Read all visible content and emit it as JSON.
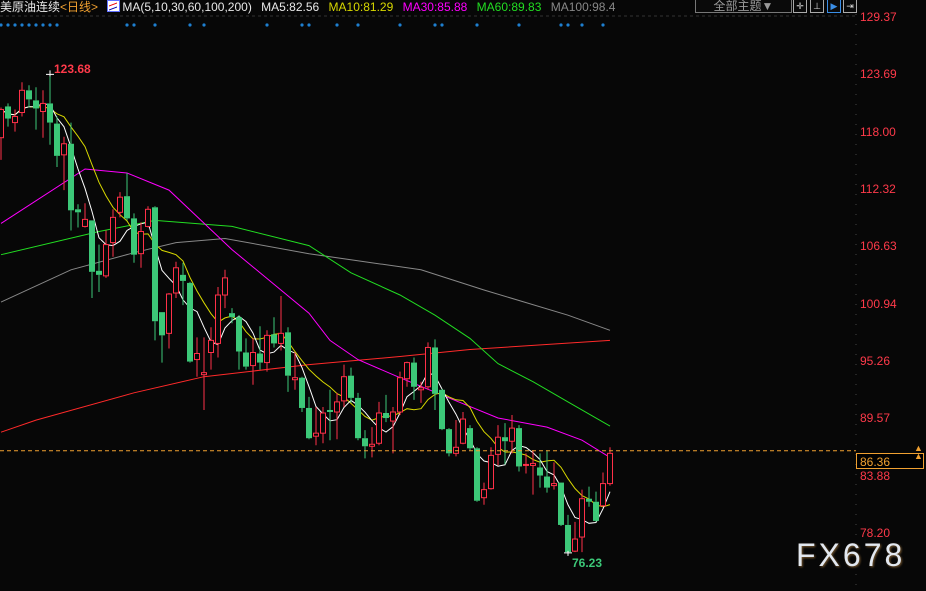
{
  "header": {
    "title": "美原油连续",
    "period": "<日线>",
    "ma_label": "MA(5,10,30,60,100,200)",
    "ma5": "MA5:82.56",
    "ma10": "MA10:81.29",
    "ma30": "MA30:85.88",
    "ma60": "MA60:89.83",
    "ma100": "MA100:98.4",
    "theme_button": "全部主题▼"
  },
  "toolbar": {
    "icons": [
      "crosshair-icon",
      "range-icon",
      "play-icon",
      "exit-icon"
    ]
  },
  "colors": {
    "up": "#ff3048",
    "down": "#3cc878",
    "ma5": "#ffffff",
    "ma10": "#d8d800",
    "ma30": "#ff00ff",
    "ma60": "#22dd22",
    "ma100": "#888888",
    "ma200": "#ff2a2a",
    "last": "#f0a030",
    "marker": "#1e7fd0"
  },
  "watermark": "FX678",
  "last_price": "86.36",
  "chart_data": {
    "type": "candlestick",
    "title": "美原油连续 <日线>",
    "ylim": [
      78.2,
      129.37
    ],
    "y_ticks": [
      "129.37",
      "123.69",
      "118.00",
      "112.32",
      "106.63",
      "100.94",
      "95.26",
      "89.57",
      "83.88",
      "78.20"
    ],
    "high_label": "123.68",
    "high_index": 7,
    "low_label": "76.23",
    "low_index": 81,
    "last": 86.36,
    "candles": [
      [
        117.4,
        120.2,
        120.4,
        115.2
      ],
      [
        120.5,
        119.3,
        120.8,
        118.5
      ],
      [
        118.9,
        119.5,
        120.2,
        118.0
      ],
      [
        119.9,
        122.1,
        122.9,
        119.5
      ],
      [
        122.1,
        121.2,
        122.6,
        120.4
      ],
      [
        121.1,
        120.3,
        122.4,
        118.2
      ],
      [
        120.0,
        120.8,
        122.1,
        117.4
      ],
      [
        120.8,
        118.9,
        123.68,
        116.7
      ],
      [
        118.8,
        115.6,
        119.5,
        114.5
      ],
      [
        115.7,
        116.8,
        117.5,
        112.2
      ],
      [
        116.8,
        110.2,
        118.9,
        108.2
      ],
      [
        110.3,
        110.0,
        110.8,
        108.5
      ],
      [
        108.6,
        109.3,
        110.9,
        108.5
      ],
      [
        109.2,
        104.1,
        109.2,
        101.5
      ],
      [
        104.2,
        103.8,
        106.8,
        102.1
      ],
      [
        103.7,
        106.8,
        108.2,
        103.5
      ],
      [
        107.0,
        109.5,
        110.3,
        105.6
      ],
      [
        110.0,
        111.5,
        112.0,
        109.5
      ],
      [
        111.6,
        109.4,
        113.9,
        109.2
      ],
      [
        109.4,
        105.8,
        109.9,
        105.0
      ],
      [
        105.9,
        108.1,
        109.0,
        104.5
      ],
      [
        108.6,
        110.3,
        110.6,
        108.5
      ],
      [
        110.5,
        99.2,
        110.6,
        97.3
      ],
      [
        100.1,
        97.8,
        100.1,
        95.1
      ],
      [
        98.0,
        101.9,
        102.0,
        96.5
      ],
      [
        102.0,
        104.5,
        105.1,
        101.5
      ],
      [
        103.8,
        103.2,
        105.0,
        100.8
      ],
      [
        103.0,
        95.2,
        103.1,
        95.1
      ],
      [
        95.4,
        96.0,
        97.6,
        93.7
      ],
      [
        93.9,
        94.1,
        97.6,
        90.4
      ],
      [
        96.1,
        97.3,
        98.6,
        94.4
      ],
      [
        97.0,
        101.8,
        102.6,
        95.6
      ],
      [
        101.8,
        103.5,
        104.3,
        100.5
      ],
      [
        100.0,
        99.6,
        100.5,
        99.0
      ],
      [
        99.6,
        96.2,
        99.8,
        94.4
      ],
      [
        96.1,
        94.7,
        97.5,
        94.4
      ],
      [
        94.8,
        96.1,
        97.5,
        92.9
      ],
      [
        96.0,
        95.1,
        98.7,
        94.4
      ],
      [
        95.1,
        97.8,
        98.3,
        94.2
      ],
      [
        97.9,
        97.0,
        99.6,
        96.6
      ],
      [
        97.0,
        98.0,
        101.7,
        96.3
      ],
      [
        98.1,
        93.8,
        98.6,
        92.2
      ],
      [
        93.4,
        93.6,
        96.1,
        92.4
      ],
      [
        93.6,
        90.6,
        93.7,
        90.2
      ],
      [
        90.6,
        87.6,
        91.7,
        87.5
      ],
      [
        87.8,
        88.1,
        90.7,
        86.9
      ],
      [
        88.1,
        90.1,
        90.7,
        87.1
      ],
      [
        90.4,
        90.2,
        92.4,
        87.4
      ],
      [
        90.2,
        91.2,
        92.1,
        87.5
      ],
      [
        91.3,
        93.7,
        94.9,
        90.7
      ],
      [
        93.8,
        91.6,
        94.6,
        91.1
      ],
      [
        91.6,
        87.6,
        92.1,
        87.4
      ],
      [
        87.6,
        86.8,
        88.4,
        85.6
      ],
      [
        86.8,
        87.0,
        88.7,
        85.7
      ],
      [
        87.1,
        90.1,
        91.2,
        86.9
      ],
      [
        90.1,
        89.6,
        91.9,
        89.2
      ],
      [
        89.3,
        90.2,
        90.7,
        86.1
      ],
      [
        90.2,
        93.6,
        94.2,
        89.9
      ],
      [
        93.5,
        95.1,
        95.2,
        92.7
      ],
      [
        95.1,
        92.7,
        95.6,
        91.4
      ],
      [
        92.4,
        92.6,
        93.2,
        91.1
      ],
      [
        92.7,
        96.6,
        97.1,
        92.4
      ],
      [
        96.6,
        92.0,
        97.4,
        90.4
      ],
      [
        92.4,
        88.5,
        92.5,
        88.4
      ],
      [
        88.5,
        86.1,
        88.6,
        85.8
      ],
      [
        86.1,
        86.7,
        89.4,
        85.8
      ],
      [
        87.1,
        89.5,
        90.2,
        87.0
      ],
      [
        88.6,
        86.6,
        88.9,
        86.4
      ],
      [
        86.6,
        81.4,
        86.7,
        81.3
      ],
      [
        81.7,
        82.5,
        83.2,
        81.0
      ],
      [
        82.6,
        85.9,
        86.7,
        82.5
      ],
      [
        86.0,
        87.7,
        88.9,
        84.9
      ],
      [
        87.7,
        87.3,
        89.1,
        85.0
      ],
      [
        87.3,
        88.6,
        89.9,
        86.1
      ],
      [
        88.6,
        84.8,
        88.9,
        84.3
      ],
      [
        84.9,
        85.0,
        86.1,
        84.1
      ],
      [
        84.9,
        85.1,
        86.4,
        82.0
      ],
      [
        84.7,
        83.9,
        86.1,
        82.7
      ],
      [
        83.8,
        82.7,
        86.4,
        82.2
      ],
      [
        82.9,
        83.1,
        85.2,
        82.5
      ],
      [
        83.2,
        79.0,
        83.2,
        78.9
      ],
      [
        79.0,
        76.3,
        80.0,
        76.23
      ],
      [
        76.4,
        77.6,
        79.3,
        76.3
      ],
      [
        77.8,
        81.6,
        82.5,
        76.3
      ],
      [
        81.6,
        81.3,
        82.8,
        80.8
      ],
      [
        81.3,
        79.4,
        82.3,
        79.3
      ],
      [
        80.9,
        83.1,
        84.2,
        80.8
      ],
      [
        83.1,
        86.1,
        86.7,
        82.9
      ]
    ],
    "candle_format": [
      "open",
      "close",
      "high",
      "low"
    ],
    "ma_long": {
      "ma30": [
        [
          0,
          108.9
        ],
        [
          12,
          114.3
        ],
        [
          18,
          113.9
        ],
        [
          24,
          112.2
        ],
        [
          33,
          106.3
        ],
        [
          44,
          100.0
        ],
        [
          47,
          97.3
        ],
        [
          51,
          95.4
        ],
        [
          57,
          93.6
        ],
        [
          64,
          91.6
        ],
        [
          71,
          89.6
        ],
        [
          78,
          88.7
        ],
        [
          83,
          87.4
        ],
        [
          87,
          85.7
        ]
      ],
      "ma60": [
        [
          0,
          105.8
        ],
        [
          14,
          108.1
        ],
        [
          22,
          109.2
        ],
        [
          33,
          108.6
        ],
        [
          44,
          106.7
        ],
        [
          50,
          104.0
        ],
        [
          57,
          101.8
        ],
        [
          62,
          99.8
        ],
        [
          67,
          97.5
        ],
        [
          71,
          95.0
        ],
        [
          76,
          93.2
        ],
        [
          81,
          91.2
        ],
        [
          86,
          89.2
        ],
        [
          87,
          88.8
        ]
      ],
      "ma100": [
        [
          0,
          101.1
        ],
        [
          10,
          104.3
        ],
        [
          19,
          106.0
        ],
        [
          25,
          107.0
        ],
        [
          32,
          107.4
        ],
        [
          44,
          105.9
        ],
        [
          60,
          104.3
        ],
        [
          69,
          102.3
        ],
        [
          81,
          99.8
        ],
        [
          87,
          98.3
        ]
      ],
      "ma200": [
        [
          0,
          88.2
        ],
        [
          5,
          89.4
        ],
        [
          19,
          92.1
        ],
        [
          29,
          93.7
        ],
        [
          44,
          94.9
        ],
        [
          57,
          95.7
        ],
        [
          67,
          96.4
        ],
        [
          76,
          96.8
        ],
        [
          87,
          97.3
        ]
      ]
    },
    "markers": [
      0,
      1,
      2,
      3,
      4,
      5,
      6,
      7,
      8,
      18,
      19,
      22,
      27,
      29,
      38,
      43,
      44,
      48,
      51,
      57,
      62,
      63,
      68,
      74,
      80,
      81,
      83,
      86
    ]
  }
}
